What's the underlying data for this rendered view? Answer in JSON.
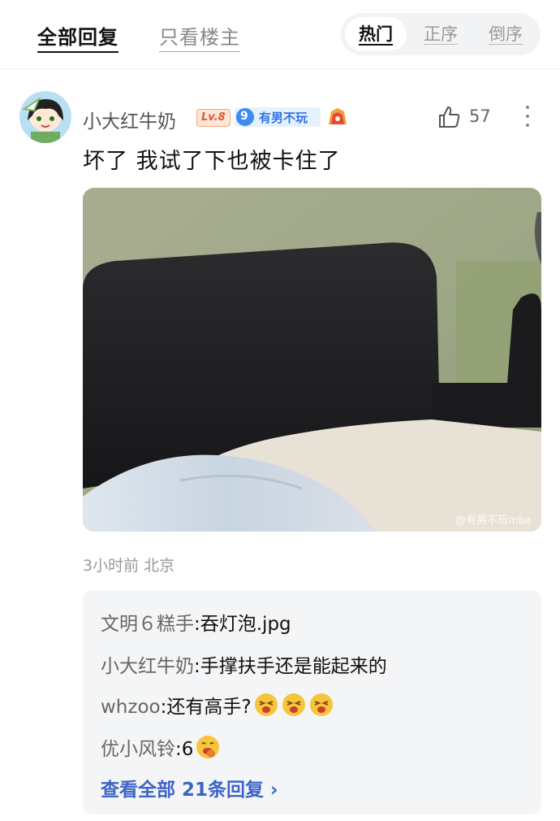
{
  "tabs": {
    "all_replies": "全部回复",
    "op_only": "只看楼主"
  },
  "sort": {
    "options": [
      "热门",
      "正序",
      "倒序"
    ],
    "selected": "热门"
  },
  "comment": {
    "username": "小大红牛奶",
    "level": "Lv.8",
    "fan_level": "9",
    "fan_group": "有男不玩",
    "likes": "57",
    "text": "坏了 我试了下也被卡住了",
    "photo_watermark": "@有男不玩mba",
    "time": "3小时前",
    "location": "北京"
  },
  "replies": [
    {
      "author": "文明６糕手",
      "sep": ":",
      "text": "吞灯泡.jpg",
      "emojis": []
    },
    {
      "author": "小大红牛奶",
      "sep": ":",
      "text": "手撑扶手还是能起来的",
      "emojis": []
    },
    {
      "author": "whzoo",
      "sep": ":",
      "text": "还有高手?",
      "emojis": [
        "laugh-emoji",
        "laugh-emoji",
        "laugh-emoji"
      ]
    },
    {
      "author": "优小风铃",
      "sep": ":",
      "text": "6",
      "emojis": [
        "yummy-emoji"
      ]
    }
  ],
  "view_all": "查看全部 21条回复 ›",
  "colors": {
    "accent_link": "#3c64c8",
    "fan_badge": "#2f73e6",
    "level_badge": "#e2543a",
    "reply_bg": "#f4f5f7"
  }
}
